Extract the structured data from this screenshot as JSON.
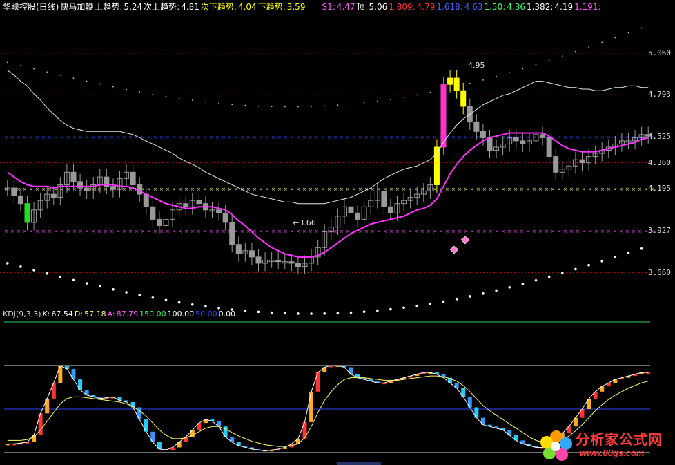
{
  "header": {
    "stock_name": "华联控股(日线)",
    "indicator_name": "快马加鞭",
    "items": [
      {
        "label": "上趋势:",
        "value": "5.24",
        "color": "#ffffff"
      },
      {
        "label": "次上趋势:",
        "value": "4.81",
        "color": "#ffffff"
      },
      {
        "label": "次下趋势:",
        "value": "4.04",
        "color": "#ffff00"
      },
      {
        "label": "下趋势:",
        "value": "3.59",
        "color": "#ffff00"
      }
    ],
    "levels": [
      {
        "label": "S1:",
        "value": "4.47",
        "color": "#ff55ff"
      },
      {
        "label": "顶:",
        "value": "5.06",
        "color": "#ffffff"
      },
      {
        "label": "1.809:",
        "value": "4.79",
        "color": "#ff3030"
      },
      {
        "label": "1.618:",
        "value": "4.63",
        "color": "#4060ff"
      },
      {
        "label": "1.50:",
        "value": "4.36",
        "color": "#33ff66"
      },
      {
        "label": "1.382:",
        "value": "4.19",
        "color": "#ffffff"
      },
      {
        "label": "1.191:",
        "value": "",
        "color": "#ff55ff"
      }
    ]
  },
  "kdj_header": {
    "name": "KDJ(9,3,3)",
    "items": [
      {
        "label": "K:",
        "value": "67.54",
        "color": "#ffffff"
      },
      {
        "label": "D:",
        "value": "57.18",
        "color": "#ffff66"
      },
      {
        "label": "A:",
        "value": "87.79",
        "color": "#ff55ff"
      },
      {
        "label": "",
        "value": "150.00",
        "color": "#33ff66"
      },
      {
        "label": "",
        "value": "100.00",
        "color": "#ffffff"
      },
      {
        "label": "",
        "value": "50.00",
        "color": "#3344ff"
      },
      {
        "label": "",
        "value": "0.00",
        "color": "#ffffff"
      }
    ]
  },
  "annotations": {
    "high": "4.95",
    "low": "3.66"
  },
  "watermark": {
    "title": "分析家公式网",
    "url": "www.88gs.com"
  },
  "chart_data": [
    {
      "type": "candlestick",
      "title": "华联控股(日线)",
      "y_ticks": [
        5.06,
        4.793,
        4.525,
        4.36,
        4.195,
        3.927,
        3.66
      ],
      "ylim": [
        3.46,
        5.31
      ],
      "horizontal_levels": [
        {
          "value": 4.793,
          "color": "#cc0000",
          "style": "dashed"
        },
        {
          "value": 4.525,
          "color": "#3344ff",
          "style": "x"
        },
        {
          "value": 4.195,
          "color": "#ffff88",
          "style": "x"
        },
        {
          "value": 3.927,
          "color": "#ff55ff",
          "style": "x"
        },
        {
          "value": 3.66,
          "color": "#cc0000",
          "style": "dashed"
        },
        {
          "value": 5.06,
          "color": "#cc0000",
          "style": "dashed"
        },
        {
          "value": 4.36,
          "color": "#cc0000",
          "style": "dashed"
        }
      ],
      "close": [
        4.2,
        4.15,
        4.1,
        3.98,
        4.06,
        4.12,
        4.16,
        4.14,
        4.22,
        4.3,
        4.24,
        4.2,
        4.18,
        4.22,
        4.27,
        4.21,
        4.19,
        4.26,
        4.3,
        4.22,
        4.16,
        4.08,
        4.0,
        3.96,
        4.0,
        4.06,
        4.1,
        4.08,
        4.12,
        4.1,
        4.06,
        4.06,
        4.04,
        3.98,
        3.84,
        3.78,
        3.8,
        3.76,
        3.72,
        3.74,
        3.74,
        3.73,
        3.73,
        3.72,
        3.7,
        3.72,
        3.76,
        3.82,
        3.92,
        3.95,
        4.02,
        4.08,
        4.04,
        4.0,
        4.08,
        4.12,
        4.18,
        4.08,
        4.04,
        4.1,
        4.12,
        4.14,
        4.16,
        4.18,
        4.22,
        4.46,
        4.86,
        4.9,
        4.82,
        4.72,
        4.62,
        4.56,
        4.52,
        4.44,
        4.46,
        4.48,
        4.52,
        4.5,
        4.48,
        4.5,
        4.54,
        4.52,
        4.4,
        4.3,
        4.32,
        4.34,
        4.38,
        4.36,
        4.4,
        4.42,
        4.44,
        4.46,
        4.48,
        4.5,
        4.5,
        4.52,
        4.54,
        4.53
      ],
      "boll_upper": [
        4.95,
        4.92,
        4.88,
        4.85,
        4.8,
        4.76,
        4.71,
        4.67,
        4.63,
        4.6,
        4.58,
        4.57,
        4.56,
        4.56,
        4.56,
        4.56,
        4.56,
        4.56,
        4.55,
        4.54,
        4.52,
        4.5,
        4.48,
        4.46,
        4.44,
        4.42,
        4.39,
        4.37,
        4.35,
        4.33,
        4.3,
        4.28,
        4.26,
        4.24,
        4.22,
        4.2,
        4.18,
        4.16,
        4.15,
        4.14,
        4.13,
        4.12,
        4.11,
        4.11,
        4.1,
        4.1,
        4.1,
        4.1,
        4.1,
        4.11,
        4.12,
        4.13,
        4.14,
        4.16,
        4.18,
        4.2,
        4.23,
        4.26,
        4.28,
        4.3,
        4.32,
        4.33,
        4.34,
        4.36,
        4.38,
        4.42,
        4.49,
        4.55,
        4.6,
        4.64,
        4.67,
        4.7,
        4.73,
        4.75,
        4.77,
        4.79,
        4.8,
        4.82,
        4.84,
        4.86,
        4.88,
        4.88,
        4.87,
        4.86,
        4.85,
        4.84,
        4.84,
        4.83,
        4.83,
        4.82,
        4.82,
        4.83,
        4.84,
        4.84,
        4.85,
        4.85,
        4.84,
        4.84
      ],
      "ma_line": [
        4.3,
        4.27,
        4.24,
        4.22,
        4.21,
        4.21,
        4.21,
        4.2,
        4.21,
        4.21,
        4.21,
        4.21,
        4.21,
        4.21,
        4.22,
        4.22,
        4.22,
        4.21,
        4.21,
        4.2,
        4.18,
        4.16,
        4.14,
        4.12,
        4.1,
        4.09,
        4.08,
        4.07,
        4.07,
        4.08,
        4.08,
        4.08,
        4.07,
        4.06,
        4.03,
        3.99,
        3.96,
        3.92,
        3.88,
        3.85,
        3.82,
        3.8,
        3.78,
        3.77,
        3.76,
        3.76,
        3.76,
        3.77,
        3.79,
        3.82,
        3.85,
        3.88,
        3.91,
        3.93,
        3.95,
        3.97,
        3.98,
        3.99,
        4.0,
        4.01,
        4.02,
        4.04,
        4.06,
        4.07,
        4.09,
        4.13,
        4.21,
        4.29,
        4.35,
        4.4,
        4.44,
        4.47,
        4.5,
        4.52,
        4.53,
        4.54,
        4.55,
        4.55,
        4.55,
        4.55,
        4.55,
        4.55,
        4.53,
        4.5,
        4.47,
        4.45,
        4.44,
        4.43,
        4.43,
        4.43,
        4.44,
        4.45,
        4.46,
        4.47,
        4.48,
        4.49,
        4.51,
        4.52
      ]
    },
    {
      "type": "bar",
      "title": "KDJ(9,3,3)",
      "ylim": [
        0,
        150
      ],
      "reference_lines": [
        150,
        100,
        50,
        0
      ],
      "k": [
        10,
        10,
        11,
        12,
        20,
        45,
        62,
        80,
        100,
        96,
        84,
        72,
        66,
        64,
        62,
        63,
        64,
        60,
        58,
        52,
        38,
        24,
        12,
        4,
        3,
        6,
        12,
        18,
        26,
        34,
        38,
        36,
        30,
        18,
        12,
        8,
        6,
        4,
        3,
        2,
        3,
        4,
        6,
        10,
        16,
        35,
        70,
        92,
        98,
        100,
        100,
        98,
        90,
        86,
        84,
        82,
        80,
        80,
        82,
        84,
        86,
        88,
        90,
        92,
        92,
        90,
        86,
        80,
        74,
        64,
        52,
        40,
        32,
        30,
        28,
        26,
        20,
        14,
        10,
        8,
        6,
        6,
        10,
        16,
        22,
        30,
        40,
        50,
        62,
        70,
        76,
        80,
        84,
        86,
        88,
        90,
        92,
        92
      ],
      "d": [
        14,
        14,
        14,
        15,
        18,
        26,
        36,
        46,
        56,
        62,
        64,
        64,
        63,
        62,
        61,
        60,
        59,
        58,
        56,
        53,
        48,
        42,
        34,
        26,
        20,
        16,
        16,
        17,
        20,
        24,
        28,
        30,
        30,
        27,
        23,
        19,
        16,
        13,
        11,
        9,
        8,
        7,
        7,
        8,
        10,
        17,
        30,
        46,
        60,
        70,
        78,
        84,
        86,
        86,
        86,
        85,
        84,
        83,
        83,
        83,
        84,
        85,
        86,
        87,
        88,
        88,
        87,
        85,
        82,
        77,
        70,
        62,
        54,
        48,
        43,
        38,
        33,
        28,
        23,
        18,
        14,
        12,
        11,
        12,
        15,
        19,
        25,
        32,
        40,
        48,
        55,
        61,
        66,
        70,
        74,
        77,
        80,
        82
      ]
    }
  ]
}
